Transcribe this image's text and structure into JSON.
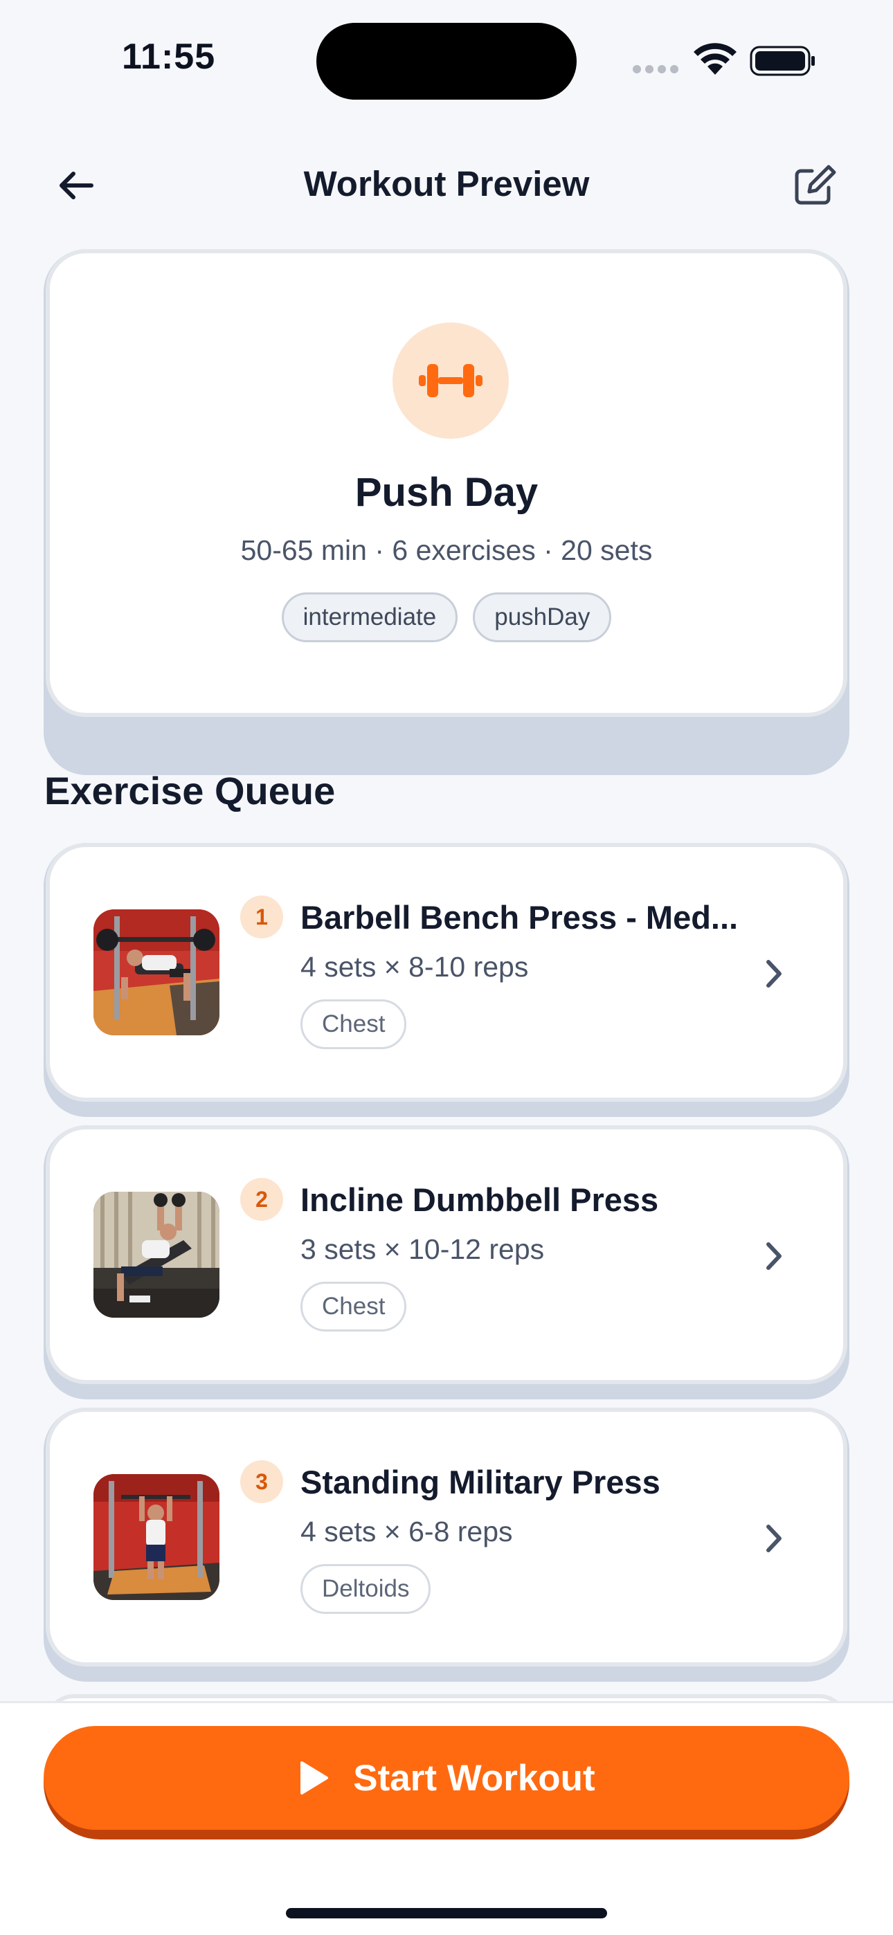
{
  "status_bar": {
    "time": "11:55"
  },
  "header": {
    "title": "Workout Preview",
    "back_icon": "arrow-left-icon",
    "edit_icon": "edit-icon"
  },
  "workout": {
    "name": "Push Day",
    "meta": "50-65 min · 6 exercises · 20 sets",
    "tags": [
      "intermediate",
      "pushDay"
    ],
    "icon": "dumbbell-icon",
    "accent": "#ff6a10"
  },
  "queue": {
    "title": "Exercise Queue",
    "exercises": [
      {
        "number": "1",
        "name": "Barbell Bench Press - Med...",
        "detail": "4 sets × 8-10 reps",
        "muscle": "Chest"
      },
      {
        "number": "2",
        "name": "Incline Dumbbell Press",
        "detail": "3 sets × 10-12 reps",
        "muscle": "Chest"
      },
      {
        "number": "3",
        "name": "Standing Military Press",
        "detail": "4 sets × 6-8 reps",
        "muscle": "Deltoids"
      }
    ]
  },
  "footer": {
    "start_label": "Start Workout",
    "start_icon": "play-icon"
  }
}
